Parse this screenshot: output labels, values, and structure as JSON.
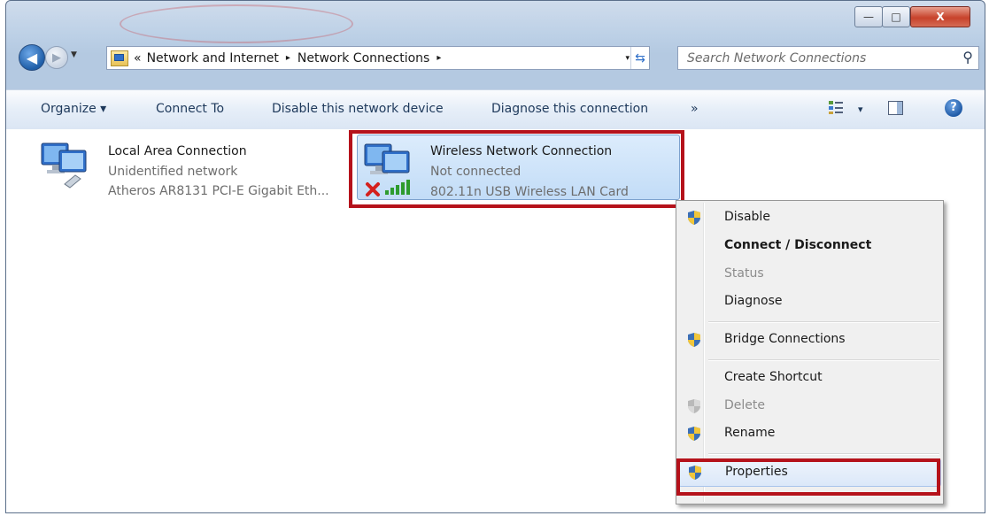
{
  "window": {
    "controls": {
      "minimize": "—",
      "maximize": "□",
      "close": "X"
    }
  },
  "address_bar": {
    "overflow_symbol": "«",
    "crumbs": [
      "Network and Internet",
      "Network Connections"
    ],
    "separator": "▸",
    "dropdown_symbol": "▾",
    "refresh_symbol": "⇆"
  },
  "search": {
    "placeholder": "Search Network Connections",
    "icon": "⚲"
  },
  "toolbar": {
    "organize": "Organize ▾",
    "connect_to": "Connect To",
    "disable_device": "Disable this network device",
    "diagnose": "Diagnose this connection",
    "more": "»",
    "view_arrow": "▾",
    "help": "?"
  },
  "connections": [
    {
      "name": "Local Area Connection",
      "status": "Unidentified network",
      "device": "Atheros AR8131 PCI-E Gigabit Eth..."
    },
    {
      "name": "Wireless Network Connection",
      "status": "Not connected",
      "device": "802.11n USB Wireless LAN Card"
    }
  ],
  "context_menu": {
    "disable": "Disable",
    "connect_disconnect": "Connect / Disconnect",
    "status": "Status",
    "diagnose": "Diagnose",
    "bridge": "Bridge Connections",
    "shortcut": "Create Shortcut",
    "delete": "Delete",
    "rename": "Rename",
    "properties": "Properties"
  },
  "colors": {
    "highlight_border": "#b5121b",
    "toolbar_text": "#1e395b",
    "selection_fill": "#c2dcf7"
  }
}
